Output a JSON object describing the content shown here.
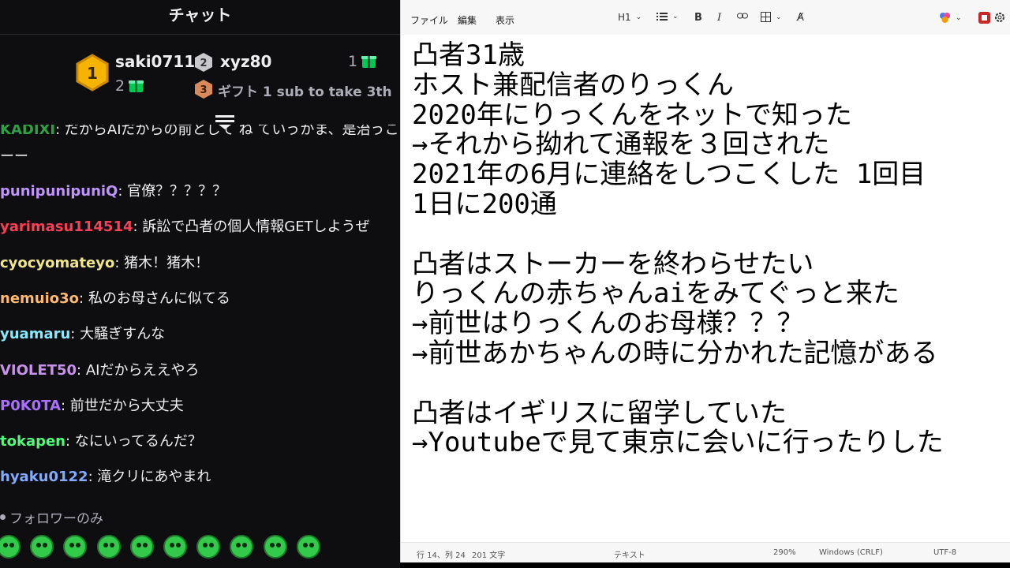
{
  "chat": {
    "title": "チャット",
    "leaderboard": {
      "rank1": {
        "badge": "1",
        "name": "saki0711",
        "count": "2"
      },
      "rank2": {
        "badge": "2",
        "name": "xyz80",
        "count": "1"
      },
      "rank3": {
        "badge": "3",
        "text": "ギフト 1 sub to take 3th"
      }
    },
    "partial_message": {
      "user": "KADIXI",
      "text": ": だからAIだからの前として ね ていうかま、是治うこ",
      "continuation": "ーー"
    },
    "messages": [
      {
        "user": "punipunipuniQ",
        "color": "#bf94ff",
        "text": ": 官僚？？？？？"
      },
      {
        "user": "yarimasu114514",
        "color": "#ff3d57",
        "text": ": 訴訟で凸者の個人情報GETしようぜ"
      },
      {
        "user": "cyocyomateyo",
        "color": "#f0e68c",
        "text": ": 猪木！猪木！"
      },
      {
        "user": "nemuio3o",
        "color": "#ffb86c",
        "text": ": 私のお母さんに似てる"
      },
      {
        "user": "yuamaru",
        "color": "#8be9fd",
        "text": ": 大騒ぎすんな"
      },
      {
        "user": "VIOLET50",
        "color": "#c792ea",
        "text": ": AIだからええやろ"
      },
      {
        "user": "P0K0TA",
        "color": "#a970ff",
        "text": ": 前世だから大丈夫"
      },
      {
        "user": "tokapen",
        "color": "#50fa7b",
        "text": ": なにいってるんだ？"
      },
      {
        "user": "hyaku0122",
        "color": "#82aaff",
        "text": ": 滝クリにあやまれ"
      }
    ],
    "followers_only": "フォロワーのみ",
    "emotes": [
      "smile-emote",
      "angry-emote",
      "glasses-emote",
      "grin-emote",
      "nerd-emote",
      "happy-emote",
      "laugh-emote",
      "hat-emote",
      "wink-emote",
      "heart-emote"
    ]
  },
  "notepad": {
    "menu": {
      "file": "ファイル",
      "edit": "編集",
      "view": "表示"
    },
    "toolbar": {
      "heading": "H1"
    },
    "lines": [
      "凸者31歳",
      "ホスト兼配信者のりっくん",
      "2020年にりっくんをネットで知った",
      "→それから拗れて通報を３回された",
      "2021年の6月に連絡をしつこくした 1回目",
      "1日に200通",
      "",
      "凸者はストーカーを終わらせたい",
      "りっくんの赤ちゃんaiをみてぐっと来た",
      "→前世はりっくんのお母様？？？",
      "→前世あかちゃんの時に分かれた記憶がある",
      "",
      "凸者はイギリスに留学していた",
      "→Youtubeで見て東京に会いに行ったりした"
    ],
    "status": {
      "position": "行 14、列 24",
      "chars": "201 文字",
      "format": "テキスト",
      "zoom": "290%",
      "line_ending": "Windows (CRLF)",
      "encoding": "UTF-8"
    }
  }
}
